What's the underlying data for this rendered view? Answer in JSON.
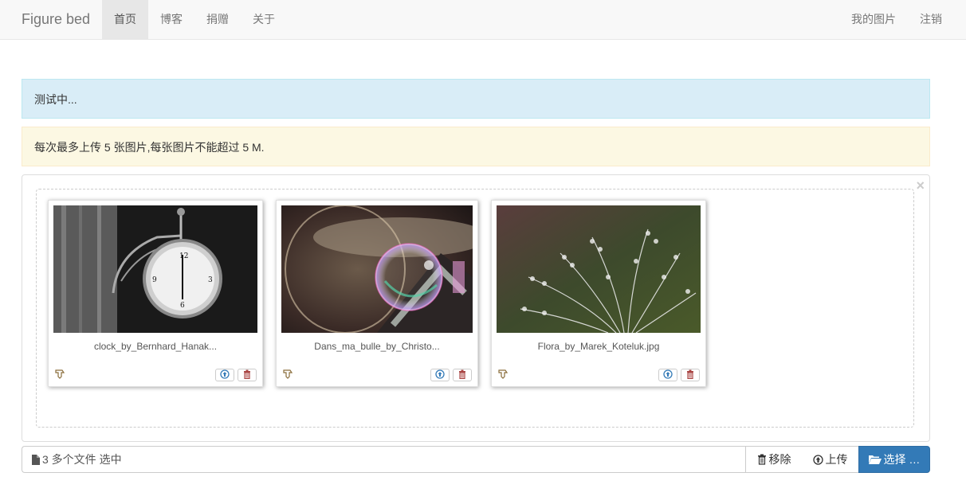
{
  "navbar": {
    "brand": "Figure bed",
    "left_items": [
      "首页",
      "博客",
      "捐赠",
      "关于"
    ],
    "right_items": [
      "我的图片",
      "注销"
    ]
  },
  "alerts": {
    "info": "测试中...",
    "warning": "每次最多上传 5 张图片,每张图片不能超过 5 M."
  },
  "preview": {
    "close_symbol": "×",
    "files": [
      {
        "caption": "clock_by_Bernhard_Hanak..."
      },
      {
        "caption": "Dans_ma_bulle_by_Christo..."
      },
      {
        "caption": "Flora_by_Marek_Koteluk.jpg"
      }
    ]
  },
  "file_input": {
    "caption": "3 多个文件 选中",
    "remove_label": "移除",
    "upload_label": "上传",
    "browse_label": "选择 …"
  },
  "colors": {
    "primary": "#337ab7",
    "info_bg": "#d9edf7",
    "warning_bg": "#fcf8e3",
    "delete_red": "#a94442",
    "upload_blue": "#337ab7"
  }
}
